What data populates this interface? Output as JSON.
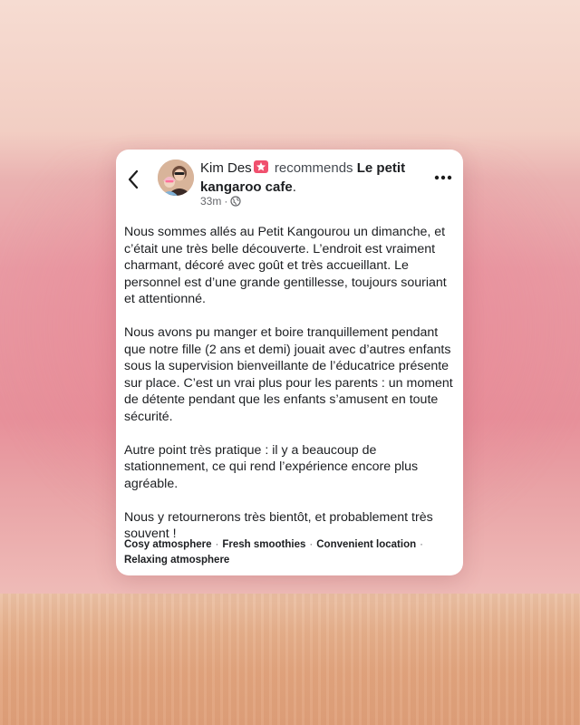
{
  "post": {
    "author": "Kim Des",
    "verb": "recommends",
    "place_line1": "Le petit",
    "place_line2": "kangaroo cafe",
    "place_suffix": ".",
    "time": "33m",
    "time_separator": "·",
    "icons": {
      "back": "chevron-left-icon",
      "badge": "recommendation-badge-icon",
      "privacy": "globe-icon",
      "more": "more-options-icon"
    },
    "badge_color": "#f0506e",
    "paragraphs": [
      "Nous sommes allés au Petit Kangourou un dimanche, et c’était une très belle découverte. L’endroit est vraiment charmant, décoré avec goût et très accueillant. Le personnel est d’une grande gentillesse, toujours souriant et attentionné.",
      "Nous avons pu manger et boire tranquillement pendant que notre fille (2 ans et demi) jouait avec d’autres enfants sous la supervision bienveillante de l’éducatrice présente sur place. C’est un vrai plus pour les parents : un moment de détente pendant que les enfants s’amusent en toute sécurité.",
      "Autre point très pratique : il y a beaucoup de stationnement, ce qui rend l’expérience encore plus agréable.",
      "Nous y retournerons très bientôt, et probablement très souvent !"
    ],
    "tags": [
      "Cosy atmosphere",
      "Fresh smoothies",
      "Convenient location",
      "Relaxing atmosphere"
    ],
    "tag_separator": "·"
  }
}
